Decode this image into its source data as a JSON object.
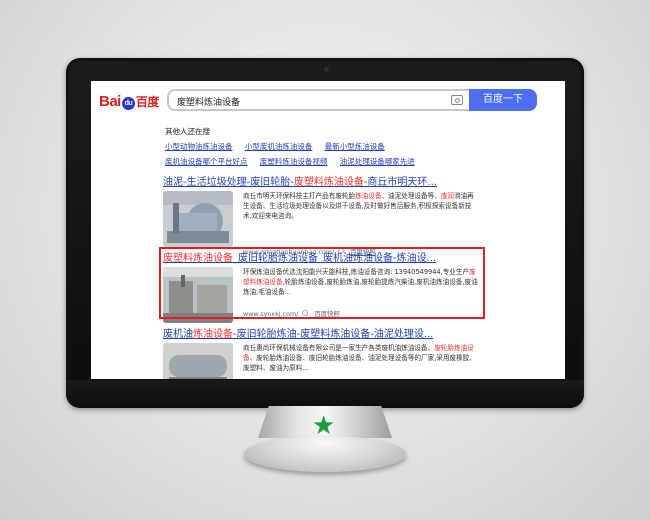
{
  "search": {
    "logo_latin": "Bai",
    "logo_paw": "du",
    "logo_cn": "百度",
    "query": "废塑料炼油设备",
    "button_label": "百度一下"
  },
  "related": {
    "title": "其他人还在搜",
    "row1": [
      "小型动物油炼油设备",
      "小型废机油炼油设备",
      "最新小型炼油设备"
    ],
    "row2": [
      "废机油设备哪个平台好点",
      "废塑料炼油设备视频",
      "油泥处理设备哪家先进"
    ]
  },
  "results": [
    {
      "title_pre": "油泥-生活垃圾处理-废旧轮胎-",
      "title_hl": "废塑料炼油设备",
      "title_post": "-商丘市明天环...",
      "desc_parts": [
        "商丘市明天环保科技主打产品有废轮胎",
        "炼油设备",
        "、油泥处理设备等、",
        "废润",
        "滑油再生设备、生活垃圾处理设备以及烘干设备,及时做好售后服务,积极探索设备新技术,欢迎来电咨询。"
      ],
      "url": "www.mingtianhuanbao.com/",
      "kuaizhao": "百度快照"
    },
    {
      "title_pre": "",
      "title_hl": "废塑料炼油设备",
      "title_post": "_废旧轮胎炼油设备_废机油炼油设备-炼油设...",
      "desc_parts": [
        "环保炼油设备优选沈阳能兴天能科技,炼油设备咨询: 13940549944,专业生产",
        "废塑料炼油设备",
        ",轮胎炼油设备,废轮胎炼油,废轮胎提炼汽柴油,废机油炼油设备,废油炼油,毛油设备..."
      ],
      "url": "www.synxkj.com/",
      "kuaizhao": "百度快照"
    },
    {
      "title_pre": "废机油",
      "title_hl": "炼油设备",
      "title_post": "-废旧轮胎炼油-废塑料炼油设备-油泥处理设...",
      "desc_parts": [
        "商丘惠尚环保机械设备有限公司是一家生产各类废机油炼油设备、",
        "废轮胎炼油设备",
        "、废轮胎炼油设备、废旧轮胎炼油设备、油泥处理设备等的厂家,采用废橡胶、废塑料、废油为原料..."
      ],
      "url": "",
      "kuaizhao": ""
    }
  ],
  "colors": {
    "link": "#2440b3",
    "highlight": "#f73131",
    "button": "#4e6ef2",
    "badge_star": "#1d9a3a"
  }
}
